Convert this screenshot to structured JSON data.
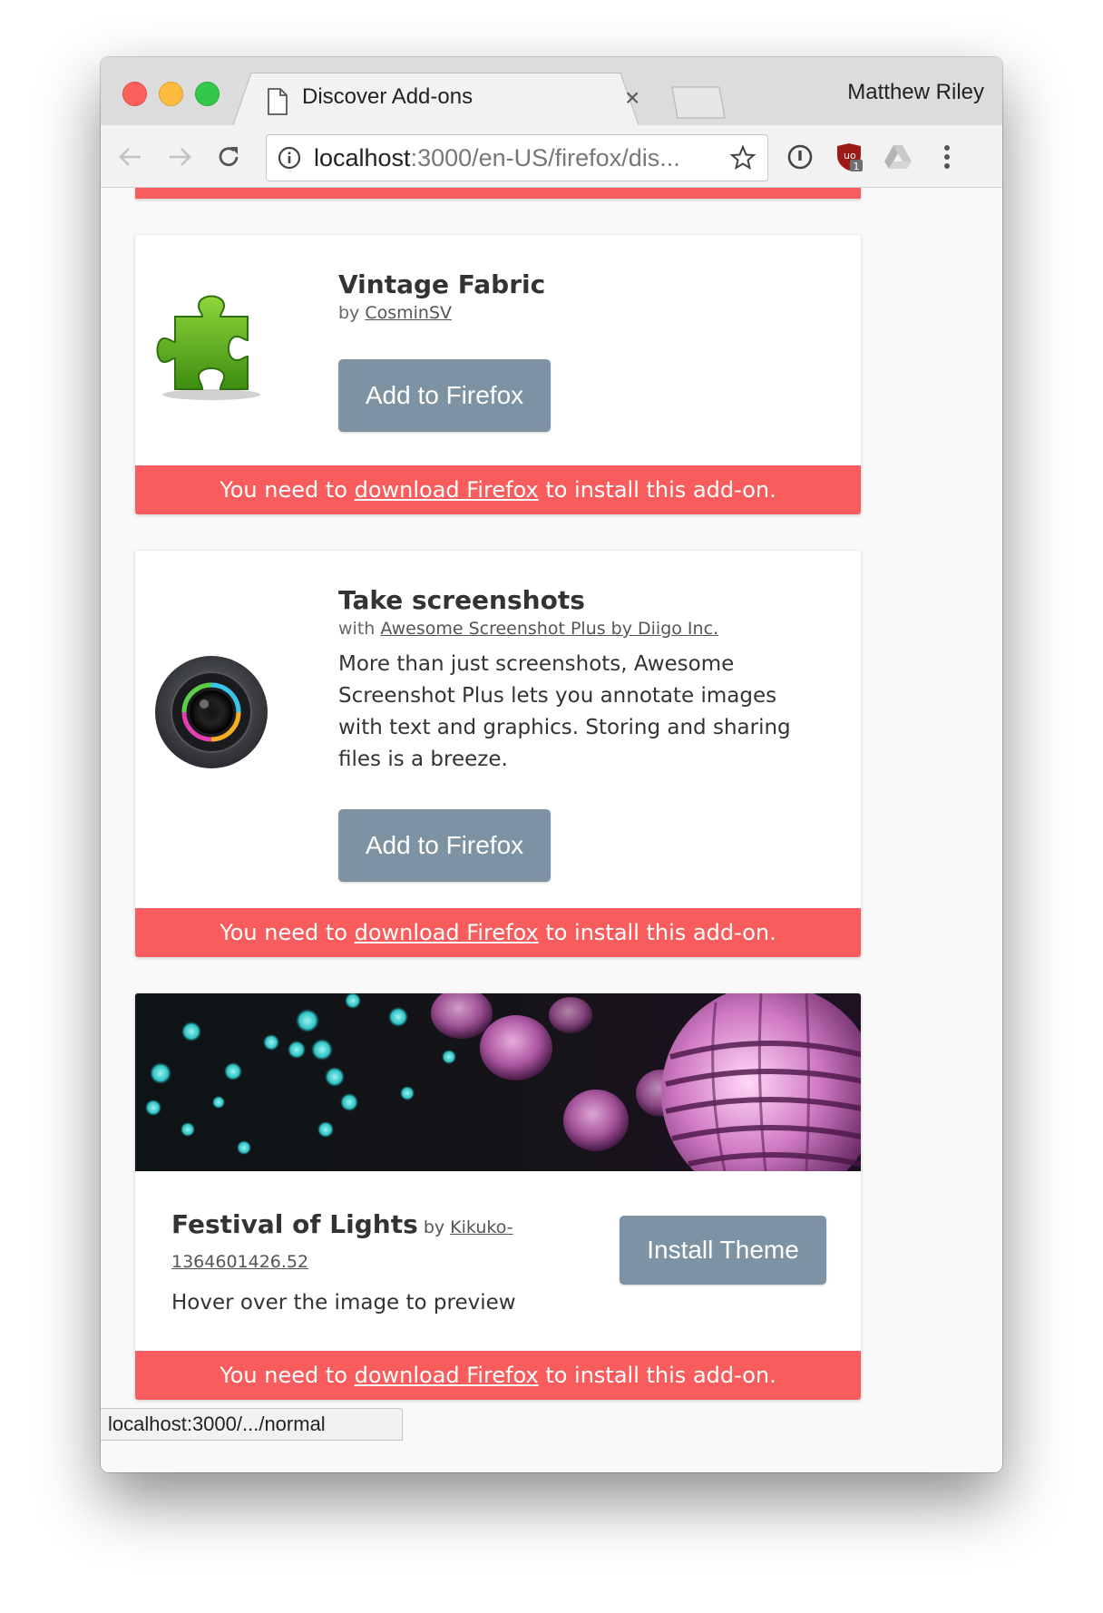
{
  "browser": {
    "tab_title": "Discover Add-ons",
    "tab_close": "×",
    "profile_name": "Matthew Riley",
    "url_host": "localhost",
    "url_rest": ":3000/en-US/firefox/dis...",
    "extension_badge": "1",
    "status_url": "localhost:3000/.../normal"
  },
  "addons": [
    {
      "title": "Vintage Fabric",
      "by_prefix": "by",
      "author": "CosminSV",
      "button": "Add to Firefox",
      "icon": "puzzle-piece-icon"
    },
    {
      "title": "Take screenshots",
      "by_prefix": "with",
      "author": "Awesome Screenshot Plus by Diigo Inc.",
      "description": "More than just screenshots, Awesome Screenshot Plus lets you annotate images with text and graphics. Storing and sharing files is a breeze.",
      "button": "Add to Firefox",
      "icon": "camera-lens-icon"
    }
  ],
  "theme": {
    "title": "Festival of Lights",
    "by_prefix": "by",
    "author": "Kikuko-1364601426.52",
    "hint": "Hover over the image to preview",
    "button": "Install Theme"
  },
  "warning": {
    "prefix": "You need to",
    "link": "download Firefox",
    "suffix": "to install this add-on."
  },
  "colors": {
    "warning_bg": "#f95c5c",
    "button_bg": "#7d93a4"
  }
}
